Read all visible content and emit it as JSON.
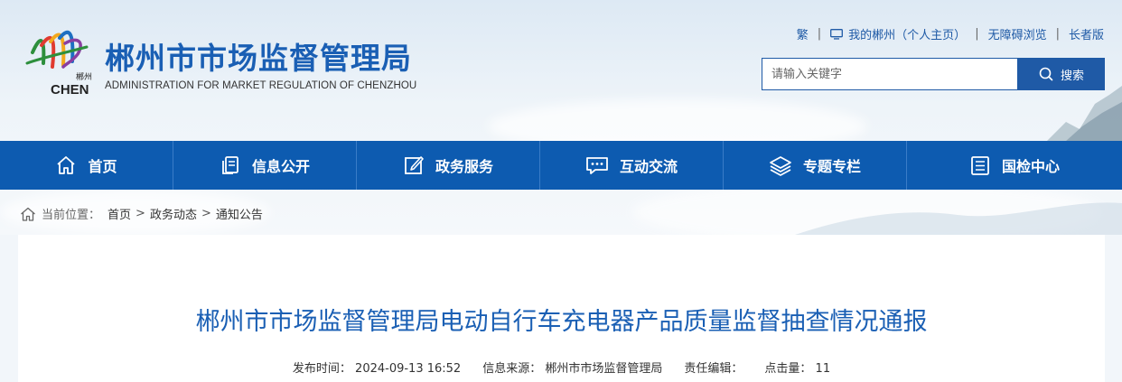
{
  "site": {
    "title": "郴州市市场监督管理局",
    "subtitle": "ADMINISTRATION FOR MARKET REGULATION OF CHENZHOU",
    "logo_text_top": "郴州",
    "logo_text_bottom": "CHEN"
  },
  "toplinks": {
    "traditional": "繁",
    "personal": "我的郴州（个人主页）",
    "accessible": "无障碍浏览",
    "elderly": "长者版"
  },
  "search": {
    "placeholder": "请输入关键字",
    "button_label": "搜索"
  },
  "nav": {
    "items": [
      {
        "label": "首页",
        "icon": "home-icon"
      },
      {
        "label": "信息公开",
        "icon": "documents-icon"
      },
      {
        "label": "政务服务",
        "icon": "edit-icon"
      },
      {
        "label": "互动交流",
        "icon": "chat-icon"
      },
      {
        "label": "专题专栏",
        "icon": "layers-icon"
      },
      {
        "label": "国检中心",
        "icon": "list-icon"
      }
    ]
  },
  "breadcrumb": {
    "label": "当前位置：",
    "items": [
      "首页",
      "政务动态",
      "通知公告"
    ]
  },
  "article": {
    "title": "郴州市市场监督管理局电动自行车充电器产品质量监督抽查情况通报",
    "meta": {
      "publish_label": "发布时间：",
      "publish_time": "2024-09-13 16:52",
      "source_label": "信息来源：",
      "source": "郴州市市场监督管理局",
      "editor_label": "责任编辑：",
      "editor": "",
      "clicks_label": "点击量：",
      "clicks": "11"
    }
  },
  "colors": {
    "primary": "#0d5bb0",
    "title_blue": "#1a5fb4"
  }
}
